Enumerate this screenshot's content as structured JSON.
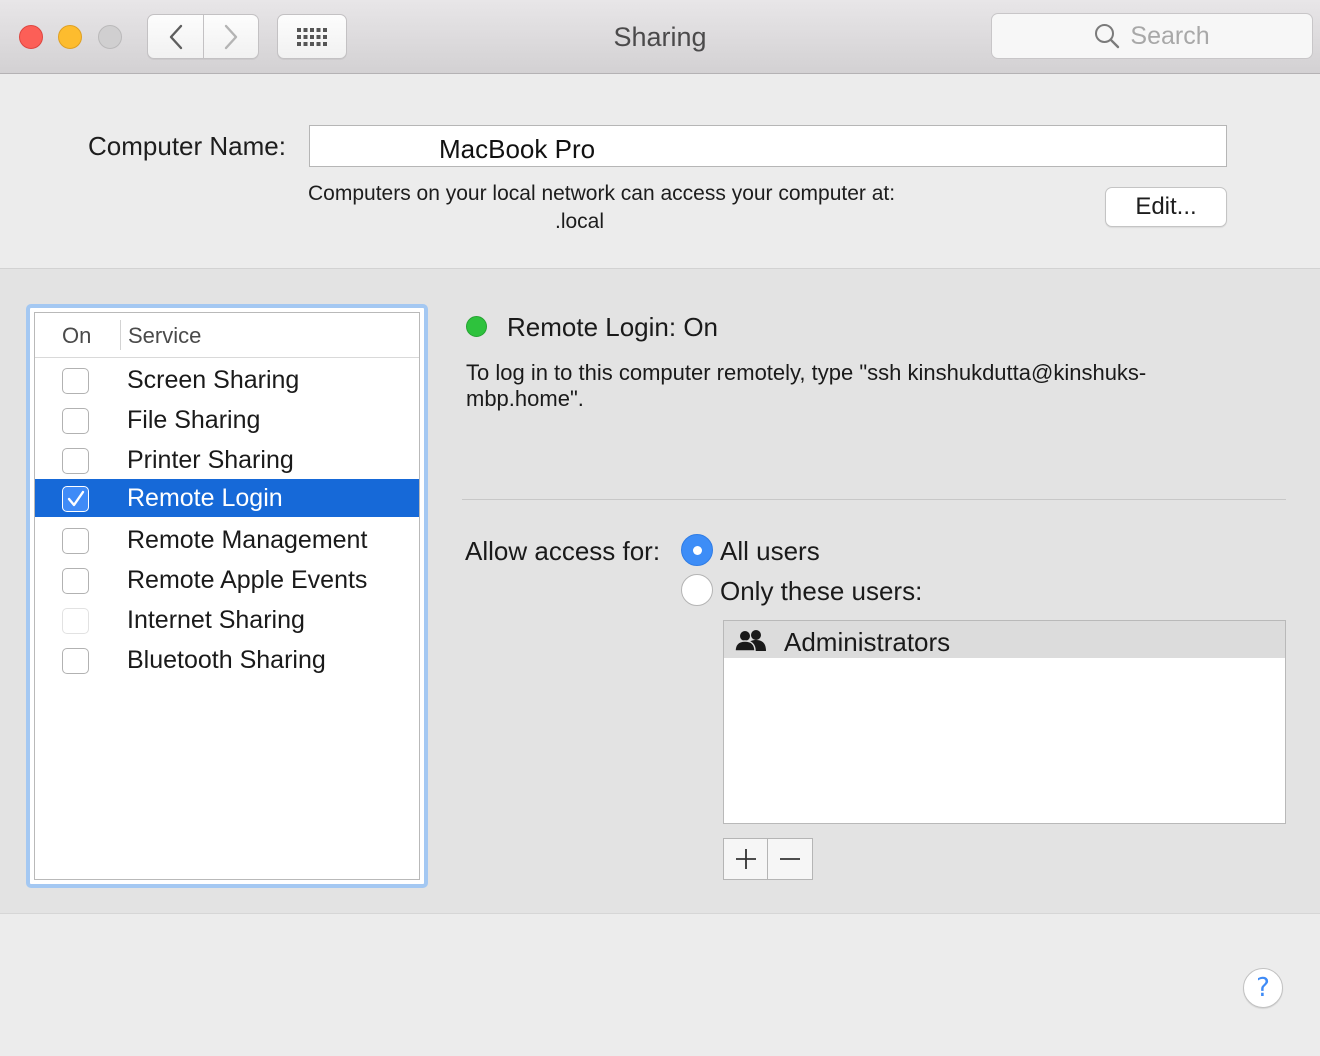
{
  "window": {
    "title": "Sharing",
    "search_placeholder": "Search"
  },
  "computer_name": {
    "label": "Computer Name:",
    "value": "MacBook Pro",
    "network_text": "Computers on your local network can access your computer at:",
    "local_address": ".local",
    "edit_label": "Edit..."
  },
  "services": {
    "header_on": "On",
    "header_service": "Service",
    "items": [
      {
        "label": "Screen Sharing",
        "checked": false,
        "selected": false
      },
      {
        "label": "File Sharing",
        "checked": false,
        "selected": false
      },
      {
        "label": "Printer Sharing",
        "checked": false,
        "selected": false
      },
      {
        "label": "Remote Login",
        "checked": true,
        "selected": true
      },
      {
        "label": "Remote Management",
        "checked": false,
        "selected": false
      },
      {
        "label": "Remote Apple Events",
        "checked": false,
        "selected": false
      },
      {
        "label": "Internet Sharing",
        "checked": false,
        "selected": false,
        "disabled": true
      },
      {
        "label": "Bluetooth Sharing",
        "checked": false,
        "selected": false
      }
    ]
  },
  "detail": {
    "status": "Remote Login: On",
    "status_color": "#2ec23d",
    "instructions": "To log in to this computer remotely, type \"ssh kinshukdutta@kinshuks-mbp.home\".",
    "allow_label": "Allow access for:",
    "option_all": "All users",
    "option_only": "Only these users:",
    "selected_option": "All users",
    "users": [
      "Administrators"
    ]
  },
  "colors": {
    "selection": "#1669d8",
    "accent": "#3d8df7"
  }
}
